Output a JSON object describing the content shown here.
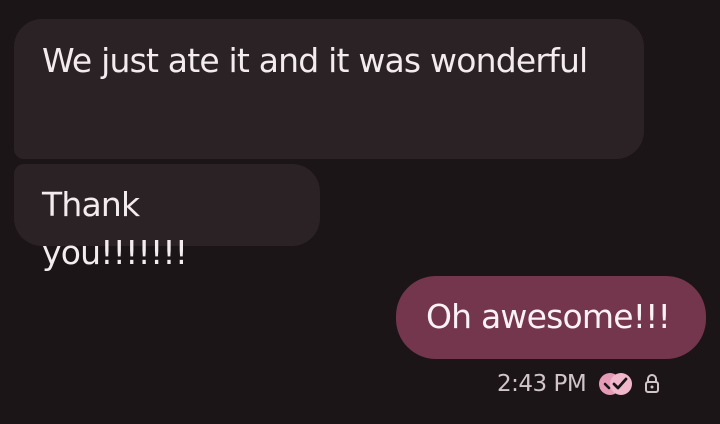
{
  "conversation": {
    "messages": [
      {
        "direction": "incoming",
        "text": "We just ate it and it was wonderful"
      },
      {
        "direction": "incoming",
        "text": "Thank you!!!!!!!"
      },
      {
        "direction": "outgoing",
        "text": "Oh awesome!!!"
      }
    ],
    "status": {
      "time": "2:43 PM",
      "read_icon": "read-receipt-icon",
      "lock_icon": "lock-icon"
    }
  },
  "colors": {
    "background": "#1c1518",
    "incoming_bubble": "#2b2225",
    "outgoing_bubble": "#74364d",
    "read_receipt": "#e59bb5"
  }
}
